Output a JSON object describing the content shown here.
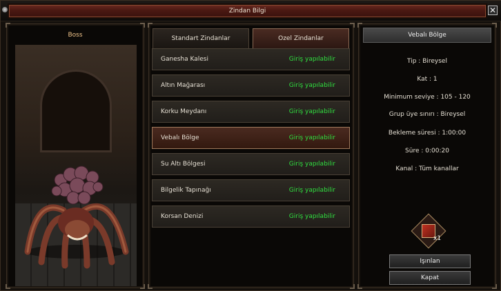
{
  "window": {
    "title": "Zindan Bilgi",
    "close_glyph": "✕"
  },
  "left_panel": {
    "boss_label": "Boss"
  },
  "tabs": [
    {
      "label": "Standart Zindanlar",
      "active": false
    },
    {
      "label": "Ozel Zindanlar",
      "active": true
    }
  ],
  "dungeons": [
    {
      "name": "Ganesha Kalesi",
      "status": "Giriş yapılabilir"
    },
    {
      "name": "Altın Mağarası",
      "status": "Giriş yapılabilir"
    },
    {
      "name": "Korku Meydanı",
      "status": "Giriş yapılabilir"
    },
    {
      "name": "Vebalı Bölge",
      "status": "Giriş yapılabilir",
      "selected": true
    },
    {
      "name": "Su Altı Bölgesi",
      "status": "Giriş yapılabilir"
    },
    {
      "name": "Bilgelik Tapınağı",
      "status": "Giriş yapılabilir"
    },
    {
      "name": "Korsan Denizi",
      "status": "Giriş yapılabilir"
    }
  ],
  "details": {
    "header": "Vebalı Bölge",
    "lines": [
      "Tip : Bireysel",
      "Kat : 1",
      "Minimum seviye : 105 - 120",
      "Grup üye sınırı : Bireysel",
      "Bekleme süresi : 1:00:00",
      "Süre : 0:00:20",
      "Kanal : Tüm kanallar"
    ],
    "item": {
      "icon": "scroll-item-icon",
      "count": "x1"
    },
    "teleport_label": "Işınlan",
    "close_label": "Kapat"
  },
  "colors": {
    "status_green": "#30e040",
    "title_bar": "#4a1812",
    "boss_label": "#f0c48a"
  }
}
